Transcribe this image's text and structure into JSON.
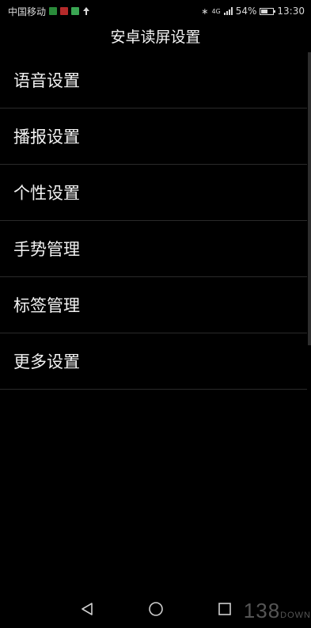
{
  "status_bar": {
    "carrier": "中国移动",
    "battery_percent": "54%",
    "time": "13:30",
    "network": "4G",
    "battery_level": 0.54
  },
  "header": {
    "title": "安卓读屏设置"
  },
  "menu": {
    "items": [
      {
        "label": "语音设置"
      },
      {
        "label": "播报设置"
      },
      {
        "label": "个性设置"
      },
      {
        "label": "手势管理"
      },
      {
        "label": "标签管理"
      },
      {
        "label": "更多设置"
      }
    ]
  },
  "nav_bar": {
    "back_icon": "back-triangle-icon",
    "home_icon": "home-circle-icon",
    "recents_icon": "recents-square-icon"
  },
  "watermark": {
    "text": "138",
    "suffix": "DOWN"
  }
}
